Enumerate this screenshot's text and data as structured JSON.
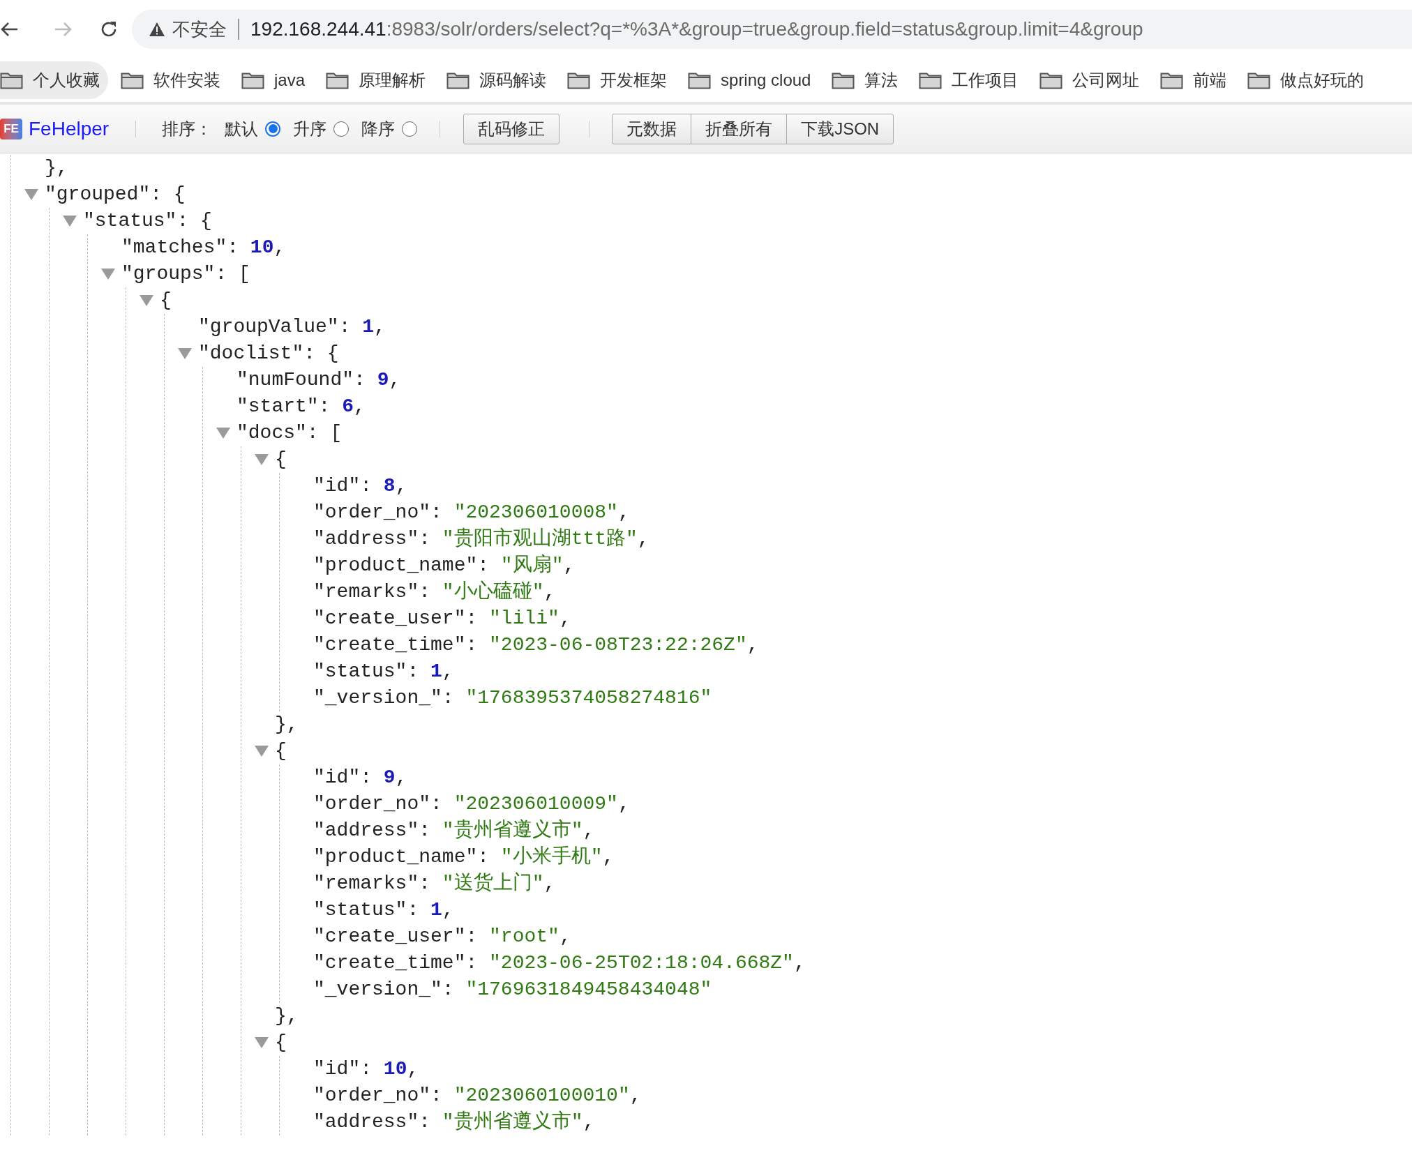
{
  "nav": {
    "back_disabled": false,
    "forward_disabled": true
  },
  "address_bar": {
    "security_label": "不安全",
    "host": "192.168.244.41",
    "path": ":8983/solr/orders/select?q=*%3A*&group=true&group.field=status&group.limit=4&group"
  },
  "bookmarks": [
    {
      "label": "个人收藏",
      "highlighted": true
    },
    {
      "label": "软件安装",
      "highlighted": false
    },
    {
      "label": "java",
      "highlighted": false
    },
    {
      "label": "原理解析",
      "highlighted": false
    },
    {
      "label": "源码解读",
      "highlighted": false
    },
    {
      "label": "开发框架",
      "highlighted": false
    },
    {
      "label": "spring cloud",
      "highlighted": false
    },
    {
      "label": "算法",
      "highlighted": false
    },
    {
      "label": "工作项目",
      "highlighted": false
    },
    {
      "label": "公司网址",
      "highlighted": false
    },
    {
      "label": "前端",
      "highlighted": false
    },
    {
      "label": "做点好玩的",
      "highlighted": false
    }
  ],
  "toolbar": {
    "logo_text": "FE",
    "brand": "FeHelper",
    "sort_label": "排序：",
    "sort_options": [
      {
        "label": "默认",
        "selected": true
      },
      {
        "label": "升序",
        "selected": false
      },
      {
        "label": "降序",
        "selected": false
      }
    ],
    "fix_button": "乱码修正",
    "button_group": [
      "元数据",
      "折叠所有",
      "下载JSON"
    ]
  },
  "tree": [
    {
      "kind": "close",
      "text": "},"
    },
    {
      "kind": "node",
      "head": "\"grouped\": {",
      "expanded": true,
      "children": [
        {
          "kind": "node",
          "head": "\"status\": {",
          "expanded": true,
          "children": [
            {
              "kind": "number",
              "key": "\"matches\": ",
              "value": "10",
              "tail": ","
            },
            {
              "kind": "node",
              "head": "\"groups\": [",
              "expanded": true,
              "children": [
                {
                  "kind": "node",
                  "head": "{",
                  "expanded": true,
                  "children": [
                    {
                      "kind": "number",
                      "key": "\"groupValue\": ",
                      "value": "1",
                      "tail": ","
                    },
                    {
                      "kind": "node",
                      "head": "\"doclist\": {",
                      "expanded": true,
                      "children": [
                        {
                          "kind": "number",
                          "key": "\"numFound\": ",
                          "value": "9",
                          "tail": ","
                        },
                        {
                          "kind": "number",
                          "key": "\"start\": ",
                          "value": "6",
                          "tail": ","
                        },
                        {
                          "kind": "node",
                          "head": "\"docs\": [",
                          "expanded": true,
                          "children": [
                            {
                              "kind": "node",
                              "head": "{",
                              "expanded": true,
                              "close": "},",
                              "children": [
                                {
                                  "kind": "number",
                                  "key": "\"id\": ",
                                  "value": "8",
                                  "tail": ","
                                },
                                {
                                  "kind": "string",
                                  "key": "\"order_no\": ",
                                  "value": "\"202306010008\"",
                                  "tail": ","
                                },
                                {
                                  "kind": "string",
                                  "key": "\"address\": ",
                                  "value": "\"贵阳市观山湖ttt路\"",
                                  "tail": ","
                                },
                                {
                                  "kind": "string",
                                  "key": "\"product_name\": ",
                                  "value": "\"风扇\"",
                                  "tail": ","
                                },
                                {
                                  "kind": "string",
                                  "key": "\"remarks\": ",
                                  "value": "\"小心磕碰\"",
                                  "tail": ","
                                },
                                {
                                  "kind": "string",
                                  "key": "\"create_user\": ",
                                  "value": "\"lili\"",
                                  "tail": ","
                                },
                                {
                                  "kind": "string",
                                  "key": "\"create_time\": ",
                                  "value": "\"2023-06-08T23:22:26Z\"",
                                  "tail": ","
                                },
                                {
                                  "kind": "number",
                                  "key": "\"status\": ",
                                  "value": "1",
                                  "tail": ","
                                },
                                {
                                  "kind": "string",
                                  "key": "\"_version_\": ",
                                  "value": "\"1768395374058274816\""
                                }
                              ]
                            },
                            {
                              "kind": "node",
                              "head": "{",
                              "expanded": true,
                              "close": "},",
                              "children": [
                                {
                                  "kind": "number",
                                  "key": "\"id\": ",
                                  "value": "9",
                                  "tail": ","
                                },
                                {
                                  "kind": "string",
                                  "key": "\"order_no\": ",
                                  "value": "\"202306010009\"",
                                  "tail": ","
                                },
                                {
                                  "kind": "string",
                                  "key": "\"address\": ",
                                  "value": "\"贵州省遵义市\"",
                                  "tail": ","
                                },
                                {
                                  "kind": "string",
                                  "key": "\"product_name\": ",
                                  "value": "\"小米手机\"",
                                  "tail": ","
                                },
                                {
                                  "kind": "string",
                                  "key": "\"remarks\": ",
                                  "value": "\"送货上门\"",
                                  "tail": ","
                                },
                                {
                                  "kind": "number",
                                  "key": "\"status\": ",
                                  "value": "1",
                                  "tail": ","
                                },
                                {
                                  "kind": "string",
                                  "key": "\"create_user\": ",
                                  "value": "\"root\"",
                                  "tail": ","
                                },
                                {
                                  "kind": "string",
                                  "key": "\"create_time\": ",
                                  "value": "\"2023-06-25T02:18:04.668Z\"",
                                  "tail": ","
                                },
                                {
                                  "kind": "string",
                                  "key": "\"_version_\": ",
                                  "value": "\"1769631849458434048\""
                                }
                              ]
                            },
                            {
                              "kind": "node",
                              "head": "{",
                              "expanded": true,
                              "children": [
                                {
                                  "kind": "number",
                                  "key": "\"id\": ",
                                  "value": "10",
                                  "tail": ","
                                },
                                {
                                  "kind": "string",
                                  "key": "\"order_no\": ",
                                  "value": "\"2023060100010\"",
                                  "tail": ","
                                },
                                {
                                  "kind": "string",
                                  "key": "\"address\": ",
                                  "value": "\"贵州省遵义市\"",
                                  "tail": ","
                                }
                              ]
                            }
                          ]
                        }
                      ]
                    }
                  ]
                }
              ]
            }
          ]
        }
      ]
    }
  ]
}
